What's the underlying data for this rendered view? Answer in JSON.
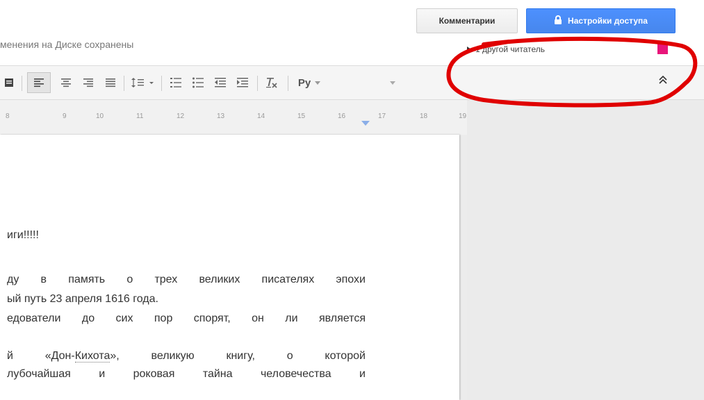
{
  "header": {
    "save_status": "менения на Диске сохранены",
    "comments_label": "Комментарии",
    "share_label": "Настройки доступа",
    "viewers_text": "1 другой читатель",
    "viewer_color": "#e8157a"
  },
  "toolbar": {
    "lang_label": "Ру"
  },
  "ruler": {
    "labels": [
      "8",
      "9",
      "10",
      "11",
      "12",
      "13",
      "14",
      "15",
      "16",
      "17",
      "18",
      "19"
    ]
  },
  "document": {
    "lines": [
      "иги!!!!!",
      "ду в память о трех великих писателях эпохи",
      "ый путь 23 апреля 1616 года.",
      "едователи до сих пор спорят, он ли является",
      "й «Дон-Кихота», великую книгу, о которой",
      "лубочайшая и роковая тайна человечества и"
    ],
    "link_word": "Кихота"
  },
  "colors": {
    "accent": "#4d90fe",
    "annotation": "#e00000"
  }
}
